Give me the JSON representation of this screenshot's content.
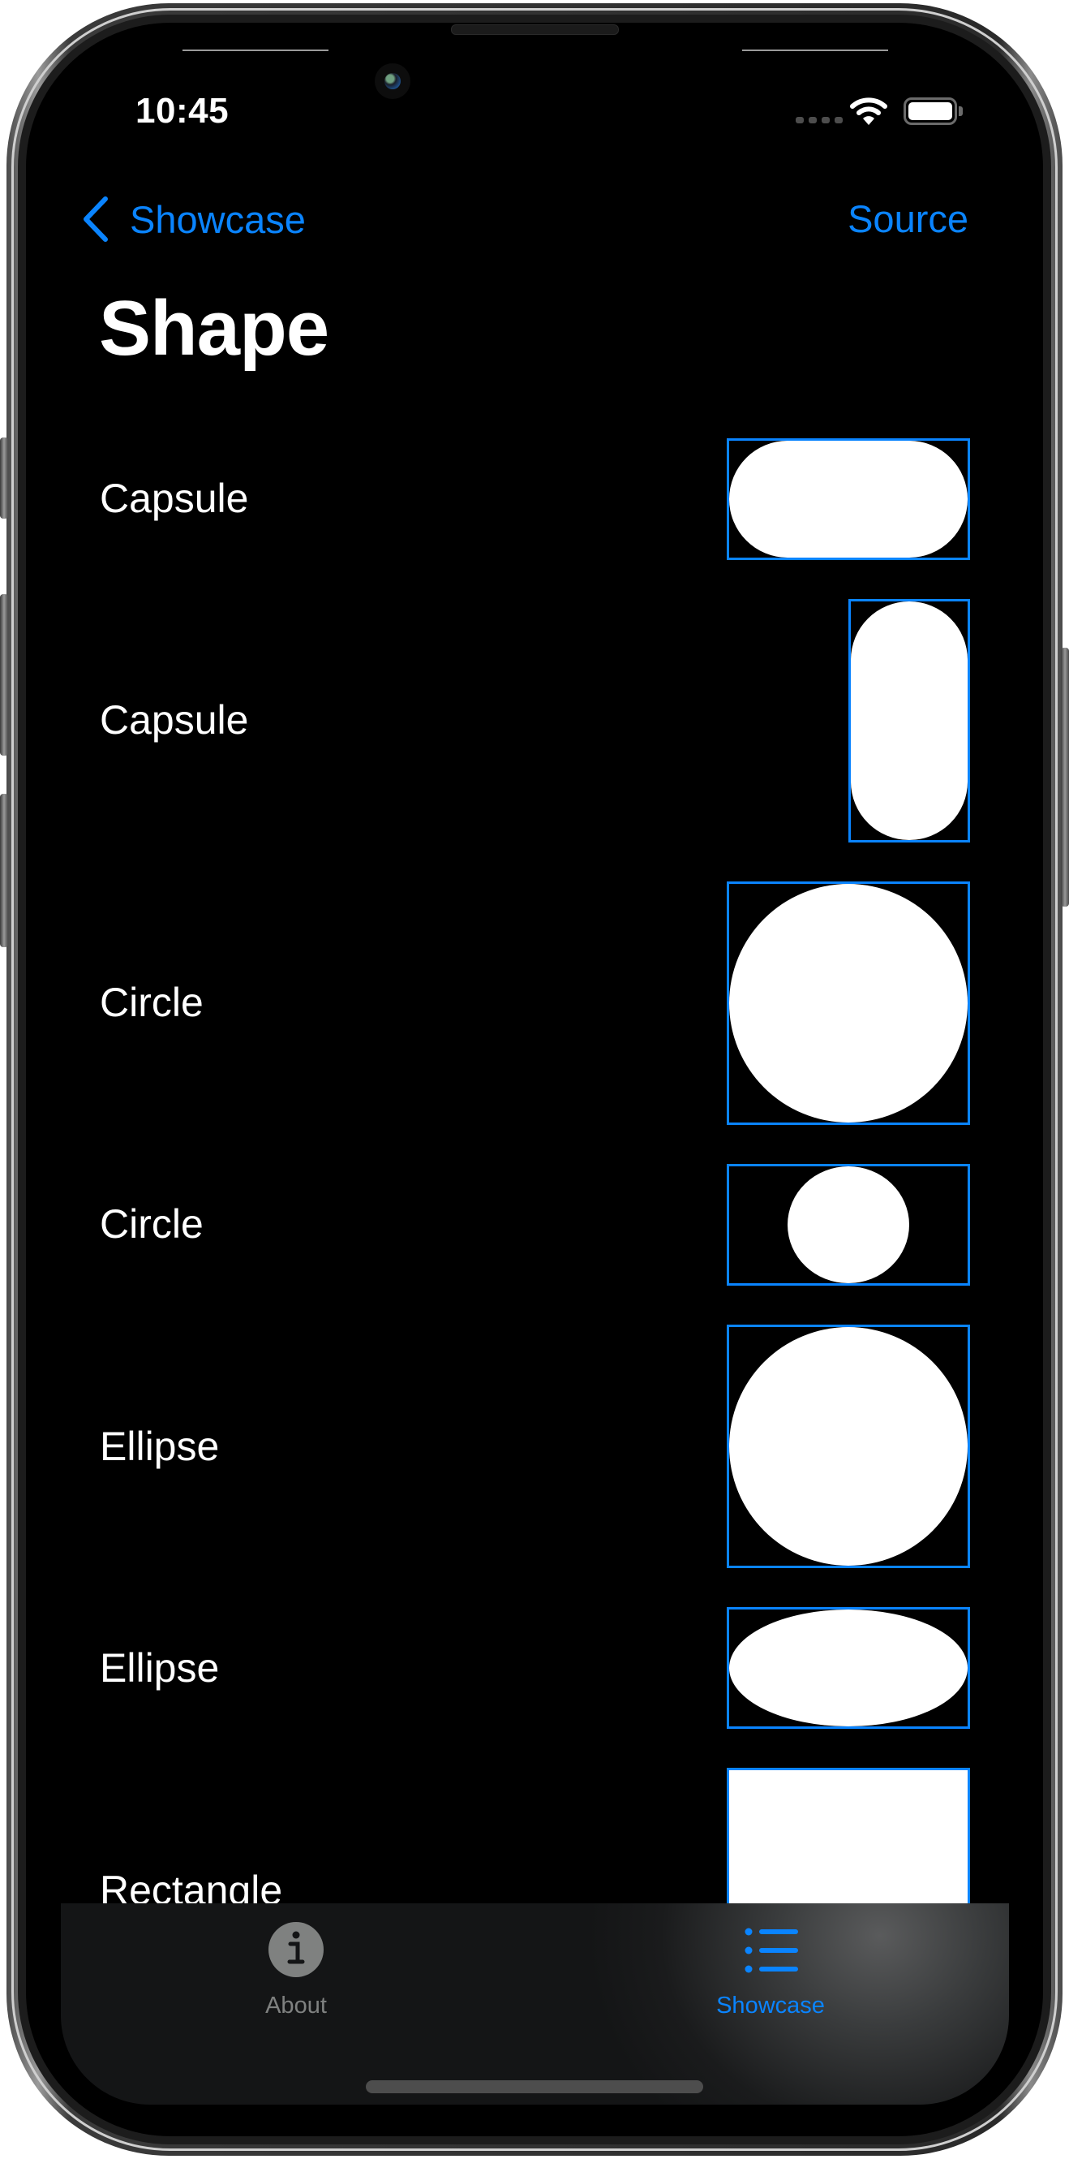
{
  "status_bar": {
    "time": "10:45",
    "icons": [
      "cellular-signal-icon",
      "wifi-icon",
      "battery-icon"
    ]
  },
  "nav": {
    "back_label": "Showcase",
    "back_icon": "chevron-left-icon",
    "action_label": "Source",
    "title": "Shape"
  },
  "colors": {
    "accent": "#0a84ff",
    "background": "#000000",
    "shape_fill": "#ffffff",
    "tab_inactive": "#7f8180"
  },
  "rows": [
    {
      "label": "Capsule",
      "shape": "capsule",
      "orientation": "horizontal"
    },
    {
      "label": "Capsule",
      "shape": "capsule",
      "orientation": "vertical"
    },
    {
      "label": "Circle",
      "shape": "circle",
      "frame": "square"
    },
    {
      "label": "Circle",
      "shape": "circle",
      "frame": "wide"
    },
    {
      "label": "Ellipse",
      "shape": "ellipse",
      "frame": "square"
    },
    {
      "label": "Ellipse",
      "shape": "ellipse",
      "frame": "wide"
    },
    {
      "label": "Rectangle",
      "shape": "rectangle",
      "frame": "square"
    }
  ],
  "tab_bar": {
    "tabs": [
      {
        "label": "About",
        "icon": "info-circle-icon",
        "selected": false
      },
      {
        "label": "Showcase",
        "icon": "list-bullet-icon",
        "selected": true
      }
    ]
  }
}
